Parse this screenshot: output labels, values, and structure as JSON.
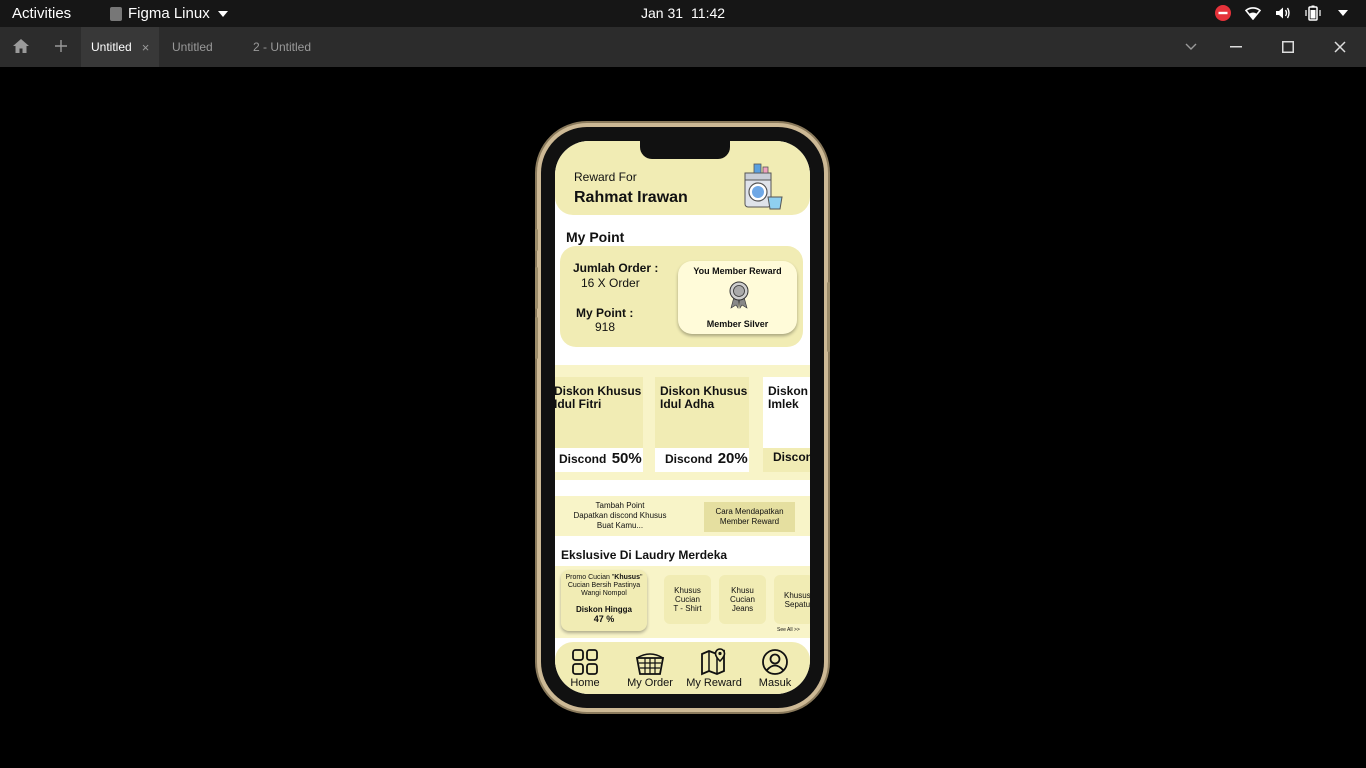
{
  "topbar": {
    "activities": "Activities",
    "app_name": "Figma Linux",
    "date": "Jan 31",
    "time": "11:42"
  },
  "tabbar": {
    "tabs": [
      {
        "label": "Untitled",
        "active": true
      },
      {
        "label": "Untitled",
        "active": false
      },
      {
        "label": "2 - Untitled",
        "active": false
      }
    ],
    "close_glyph": "×"
  },
  "app": {
    "header": {
      "reward_for": "Reward For",
      "user_name": "Rahmat Irawan"
    },
    "my_point": {
      "title": "My Point",
      "order_label": "Jumlah Order :",
      "order_value": "16 X Order",
      "point_label": "My Point :",
      "point_value": "918",
      "member_title": "You Member Reward",
      "member_level": "Member Silver"
    },
    "promos": [
      {
        "title_l1": "Diskon Khusus",
        "title_l2": "Idul Fitri",
        "disc_label": "Discond",
        "disc_value": "50%"
      },
      {
        "title_l1": "Diskon Khusus",
        "title_l2": "Idul Adha",
        "disc_label": "Discond",
        "disc_value": "20%"
      },
      {
        "title_l1": "Diskon",
        "title_l2": "Imlek",
        "disc_label": "Discon",
        "disc_value": ""
      }
    ],
    "tambah": {
      "line1": "Tambah Point",
      "line2": "Dapatkan discond Khusus",
      "line3": "Buat Kamu...",
      "button_l1": "Cara Mendapatkan",
      "button_l2": "Member Reward"
    },
    "eksklusif": {
      "title": "Ekslusive Di Laudry Merdeka",
      "main_l1_prefix": "Promo Cucian \"",
      "main_l1_bold": "Khusus",
      "main_l1_suffix": "\"",
      "main_l2": "Cucian Bersih  Pastinya",
      "main_l3": "Wangi Nompol",
      "disk_label": "Diskon Hingga",
      "disk_value": "47 %",
      "items": [
        {
          "l1": "Khusus",
          "l2": "Cucian",
          "l3": "T - Shirt"
        },
        {
          "l1": "Khusu",
          "l2": "Cucian",
          "l3": "Jeans"
        },
        {
          "l1": "Khusus",
          "l2": "Sepatu",
          "l3": ""
        }
      ],
      "see_all": "See All >>"
    },
    "nav": [
      {
        "label": "Home",
        "icon": "grid-icon"
      },
      {
        "label": "My Order",
        "icon": "basket-icon"
      },
      {
        "label": "My Reward",
        "icon": "map-pin-icon"
      },
      {
        "label": "Masuk",
        "icon": "user-circle-icon"
      }
    ]
  },
  "colors": {
    "accent": "#f1ecb4",
    "accent_light": "#f8f4c8",
    "phone_frame": "#cdb995"
  }
}
